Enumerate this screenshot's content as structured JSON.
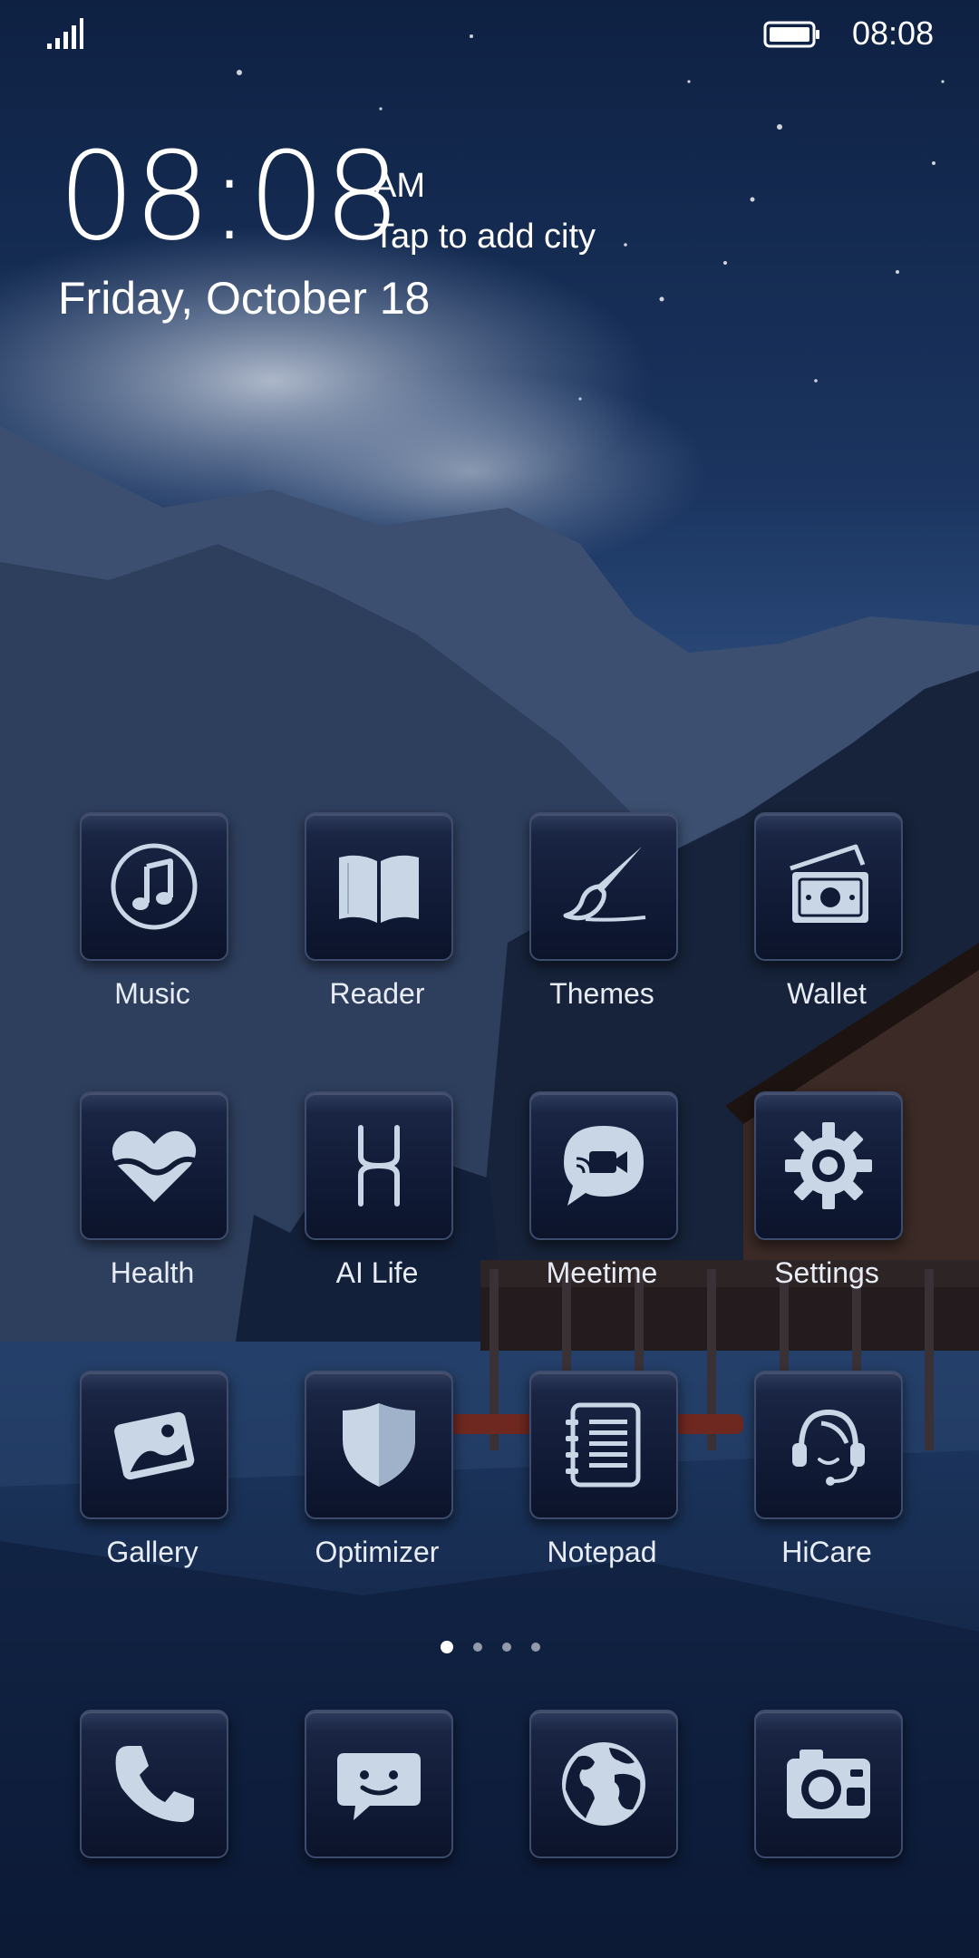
{
  "status_bar": {
    "time": "08:08"
  },
  "clock_widget": {
    "time": "08:08",
    "ampm": "AM",
    "city_prompt": "Tap to add city",
    "date": "Friday, October 18"
  },
  "apps": [
    {
      "label": "Music",
      "icon": "music-note-icon"
    },
    {
      "label": "Reader",
      "icon": "open-book-icon"
    },
    {
      "label": "Themes",
      "icon": "paintbrush-icon"
    },
    {
      "label": "Wallet",
      "icon": "wallet-cash-icon"
    },
    {
      "label": "Health",
      "icon": "heart-icon"
    },
    {
      "label": "AI Life",
      "icon": "ai-life-icon"
    },
    {
      "label": "Meetime",
      "icon": "video-chat-icon"
    },
    {
      "label": "Settings",
      "icon": "gear-icon"
    },
    {
      "label": "Gallery",
      "icon": "photo-icon"
    },
    {
      "label": "Optimizer",
      "icon": "shield-icon"
    },
    {
      "label": "Notepad",
      "icon": "notepad-icon"
    },
    {
      "label": "HiCare",
      "icon": "headset-icon"
    }
  ],
  "page_indicator": {
    "pages": 4,
    "current": 1
  },
  "dock": [
    {
      "icon": "phone-icon"
    },
    {
      "icon": "message-icon"
    },
    {
      "icon": "browser-globe-icon"
    },
    {
      "icon": "camera-icon"
    }
  ],
  "colors": {
    "sky_top": "#0e2143",
    "sky_mid": "#2a4a7a",
    "icon_glyph": "#c9d6e6",
    "tile_dark": "#111b36"
  }
}
